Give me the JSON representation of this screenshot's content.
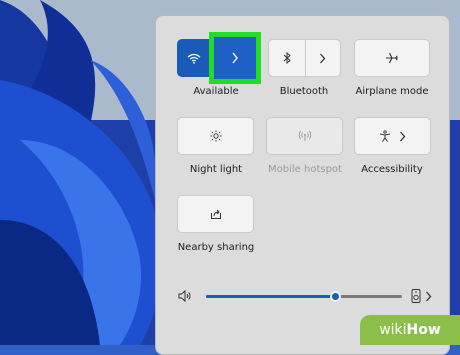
{
  "quick_settings": {
    "wifi": {
      "label": "Available",
      "icon": "wifi-icon",
      "expand_icon": "chevron-right-icon",
      "state": "on"
    },
    "bluetooth": {
      "label": "Bluetooth",
      "icon": "bluetooth-icon",
      "expand_icon": "chevron-right-icon",
      "state": "off"
    },
    "airplane": {
      "label": "Airplane mode",
      "icon": "airplane-icon",
      "state": "off"
    },
    "night_light": {
      "label": "Night light",
      "icon": "brightness-icon",
      "state": "off"
    },
    "mobile_hotspot": {
      "label": "Mobile hotspot",
      "icon": "hotspot-icon",
      "state": "disabled"
    },
    "accessibility": {
      "label": "Accessibility",
      "icon": "accessibility-icon",
      "expand_icon": "chevron-right-icon",
      "state": "off"
    },
    "nearby_sharing": {
      "label": "Nearby sharing",
      "icon": "share-icon",
      "state": "off"
    }
  },
  "volume": {
    "icon": "speaker-icon",
    "level": 0.66,
    "device_icon": "speaker-device-icon",
    "expand_icon": "chevron-right-icon"
  },
  "colors": {
    "accent": "#1a5bb8",
    "highlight": "#22dd22",
    "panel": "#dcdcdc",
    "watermark": "#8cbf4a"
  },
  "watermark": {
    "wiki": "wiki",
    "how": "How"
  }
}
